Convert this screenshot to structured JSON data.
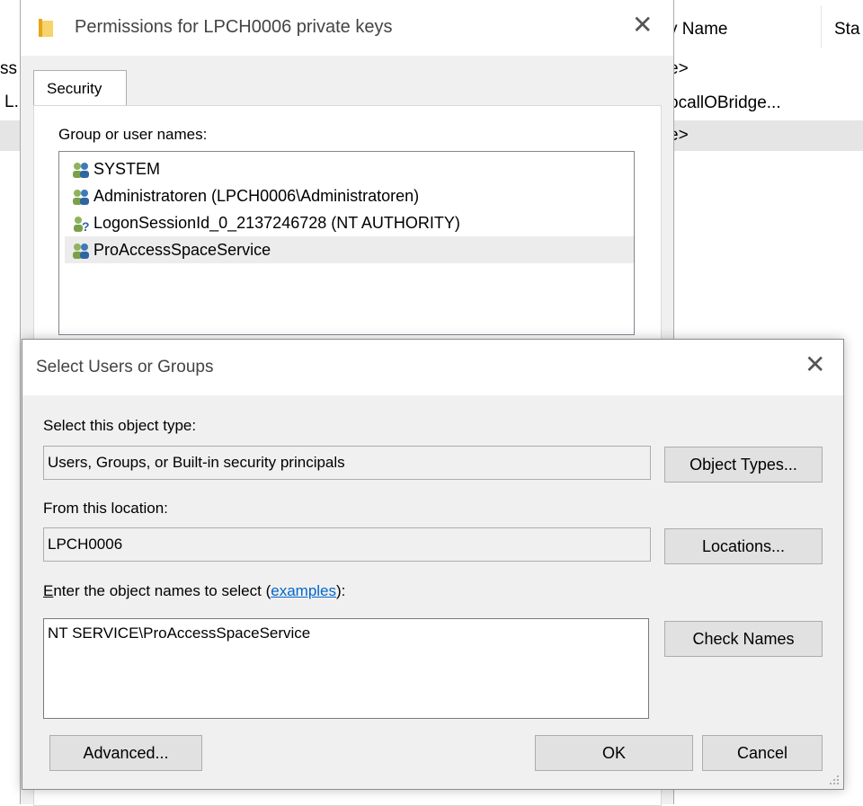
{
  "background": {
    "columns": [
      "Display Name",
      "Status"
    ],
    "columns_visible": [
      "y Name",
      "Sta"
    ],
    "left_fragments": [
      "ss",
      "L."
    ],
    "rows_visible": [
      "e>",
      "ocallOBridge...",
      "e>"
    ]
  },
  "permissions_dialog": {
    "title": "Permissions for LPCH0006 private keys",
    "tab": "Security",
    "group_label": "Group or user names:",
    "users": [
      {
        "name": "SYSTEM",
        "icon": "group-icon"
      },
      {
        "name": "Administratoren (LPCH0006\\Administratoren)",
        "icon": "group-icon"
      },
      {
        "name": "LogonSessionId_0_2137246728 (NT AUTHORITY)",
        "icon": "unknown-user-icon"
      },
      {
        "name": "ProAccessSpaceService",
        "icon": "group-icon",
        "selected": true
      }
    ]
  },
  "select_dialog": {
    "title": "Select Users or Groups",
    "object_type_label": "Select this object type:",
    "object_type_value": "Users, Groups, or Built-in security principals",
    "object_types_button": "Object Types...",
    "location_label": "From this location:",
    "location_value": "LPCH0006",
    "locations_button": "Locations...",
    "enter_label_prefix": "E",
    "enter_label_mid": "nter the object names to select (",
    "enter_label_link": "examples",
    "enter_label_suffix": "):",
    "names_value": "NT SERVICE\\ProAccessSpaceService",
    "check_names_button": "Check Names",
    "advanced_button": "Advanced...",
    "ok_button": "OK",
    "cancel_button": "Cancel"
  },
  "colors": {
    "link": "#0066cc",
    "dialog_bg": "#f0f0f0",
    "selection": "#ececec"
  }
}
